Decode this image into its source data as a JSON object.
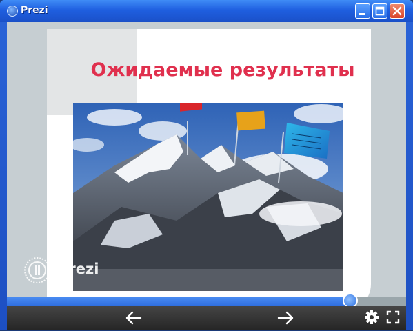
{
  "window": {
    "title": "Prezi"
  },
  "slide": {
    "title": "Ожидаемые результаты",
    "watermark": "Prezi"
  },
  "player": {
    "progress_fraction": 0.86
  },
  "icons": {
    "app": "prezi-app-icon",
    "minimize": "minimize-icon",
    "maximize": "maximize-icon",
    "close": "close-icon",
    "prev": "arrow-left-icon",
    "next": "arrow-right-icon",
    "settings": "gear-icon",
    "fullscreen": "fullscreen-icon"
  }
}
